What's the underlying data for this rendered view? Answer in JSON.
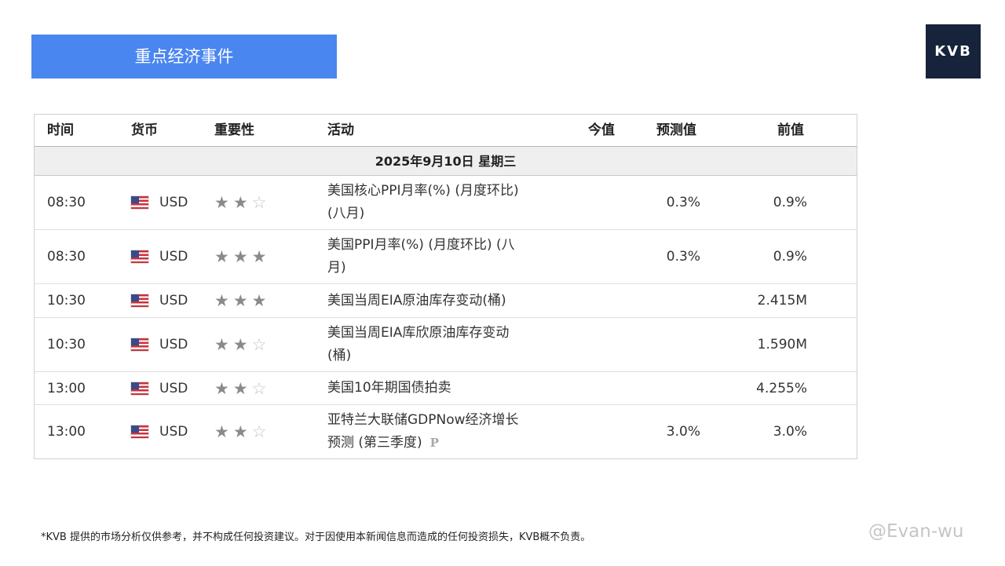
{
  "banner": {
    "title": "重点经济事件"
  },
  "logo": {
    "text": "KVB"
  },
  "table": {
    "headers": {
      "time": "时间",
      "currency": "货币",
      "importance": "重要性",
      "activity": "活动",
      "actual": "今值",
      "forecast": "预测值",
      "previous": "前值"
    },
    "date_label": "2025年9月10日  星期三",
    "rows": [
      {
        "time": "08:30",
        "currency": "USD",
        "stars": 2,
        "activity_line1": "美国核心PPI月率(%) (月度环比)",
        "activity_line2": "(八月)",
        "actual": "",
        "forecast": "0.3%",
        "previous": "0.9%"
      },
      {
        "time": "08:30",
        "currency": "USD",
        "stars": 3,
        "activity_line1": "美国PPI月率(%) (月度环比) (八",
        "activity_line2": "月)",
        "actual": "",
        "forecast": "0.3%",
        "previous": "0.9%"
      },
      {
        "time": "10:30",
        "currency": "USD",
        "stars": 3,
        "activity_line1": "美国当周EIA原油库存变动(桶)",
        "activity_line2": "",
        "actual": "",
        "forecast": "",
        "previous": "2.415M"
      },
      {
        "time": "10:30",
        "currency": "USD",
        "stars": 2,
        "activity_line1": "美国当周EIA库欣原油库存变动",
        "activity_line2": "(桶)",
        "actual": "",
        "forecast": "",
        "previous": "1.590M"
      },
      {
        "time": "13:00",
        "currency": "USD",
        "stars": 2,
        "activity_line1": "美国10年期国债拍卖",
        "activity_line2": "",
        "actual": "",
        "forecast": "",
        "previous": "4.255%"
      },
      {
        "time": "13:00",
        "currency": "USD",
        "stars": 2,
        "activity_line1": "亚特兰大联储GDPNow经济增长",
        "activity_line2": "预测 (第三季度)",
        "activity_mark": "P",
        "actual": "",
        "forecast": "3.0%",
        "previous": "3.0%"
      }
    ]
  },
  "icons": {
    "flag": "us-flag-icon",
    "star_filled": "star-filled-icon",
    "star_empty": "star-empty-icon"
  },
  "colors": {
    "banner": "#4a86f0",
    "logo_bg": "#16233a",
    "date_row_bg": "#efefef"
  },
  "footer": {
    "disclaimer": "*KVB 提供的市场分析仅供参考，并不构成任何投资建议。对于因使用本新闻信息而造成的任何投资损失，KVB概不负责。",
    "watermark": "@Evan-wu"
  }
}
